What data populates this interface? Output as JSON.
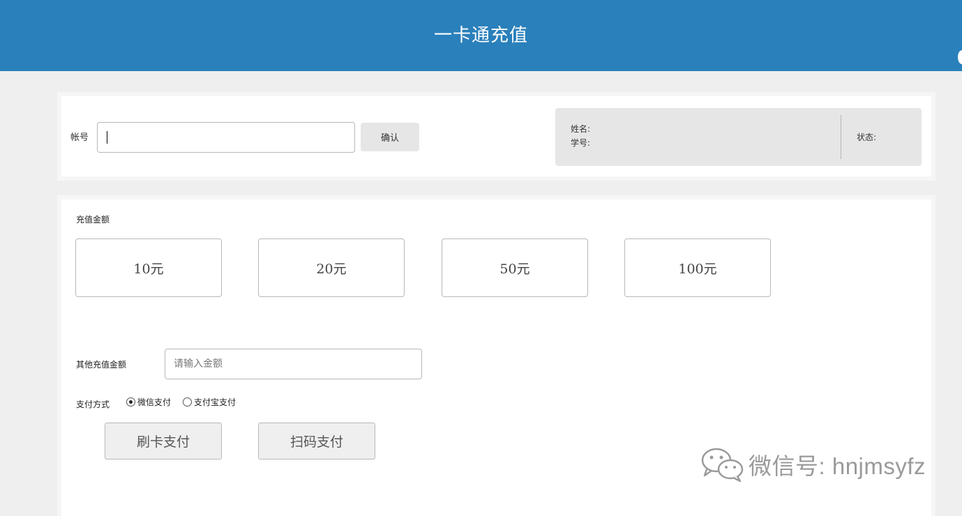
{
  "header": {
    "title": "一卡通充值"
  },
  "account": {
    "label": "帐号",
    "input_value": "",
    "confirm_label": "确认"
  },
  "info": {
    "name_label": "姓名:",
    "id_label": "学号:",
    "status_label": "状态:"
  },
  "recharge": {
    "section_label": "充值金额",
    "amounts": [
      "10元",
      "20元",
      "50元",
      "100元"
    ],
    "other_label": "其他充值金额",
    "other_placeholder": "请输入金额",
    "pay_method_label": "支付方式",
    "pay_options": [
      {
        "label": "微信支付",
        "checked": true
      },
      {
        "label": "支付宝支付",
        "checked": false
      }
    ],
    "buttons": {
      "card_pay": "刷卡支付",
      "scan_pay": "扫码支付"
    }
  },
  "watermark": {
    "text": "微信号: hnjmsyfz",
    "icon": "wechat-logo-icon"
  },
  "colors": {
    "header": "#2a80bb",
    "background": "#efefef",
    "info_box": "#e6e6e6"
  }
}
